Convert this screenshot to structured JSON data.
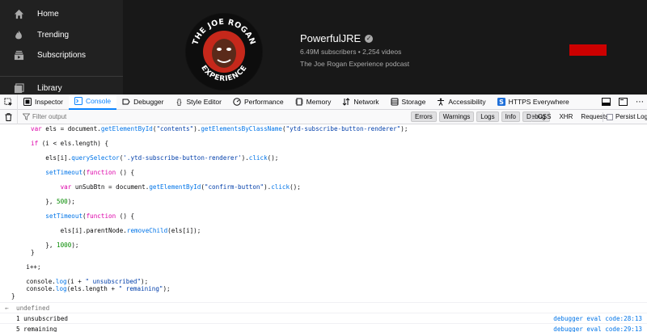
{
  "youtube": {
    "sidebar": [
      {
        "label": "Home",
        "icon": "home-icon"
      },
      {
        "label": "Trending",
        "icon": "flame-icon"
      },
      {
        "label": "Subscriptions",
        "icon": "subscriptions-icon"
      },
      {
        "label": "Library",
        "icon": "library-icon"
      }
    ],
    "channel": {
      "logo_text_top": "THE JOE ROGAN",
      "logo_text_bottom": "EXPERIENCE",
      "name": "PowerfulJRE",
      "stats": "6.49M subscribers • 2,254 videos",
      "description": "The Joe Rogan Experience podcast"
    },
    "colors": {
      "background": "#181818",
      "sidebar": "#212121",
      "subscribe": "#cc0000"
    }
  },
  "devtools": {
    "tabs": [
      {
        "label": "Inspector",
        "icon": "inspector-icon"
      },
      {
        "label": "Console",
        "icon": "console-icon"
      },
      {
        "label": "Debugger",
        "icon": "debugger-icon"
      },
      {
        "label": "Style Editor",
        "icon": "style-editor-icon"
      },
      {
        "label": "Performance",
        "icon": "performance-icon"
      },
      {
        "label": "Memory",
        "icon": "memory-icon"
      },
      {
        "label": "Network",
        "icon": "network-icon"
      },
      {
        "label": "Storage",
        "icon": "storage-icon"
      },
      {
        "label": "Accessibility",
        "icon": "accessibility-icon"
      },
      {
        "label": "HTTPS Everywhere",
        "icon": "https-everywhere-icon"
      }
    ],
    "active_tab": "Console",
    "filter_placeholder": "Filter output",
    "levels": [
      "Errors",
      "Warnings",
      "Logs",
      "Info",
      "Debug"
    ],
    "net_filters": [
      "CSS",
      "XHR",
      "Requests"
    ],
    "persist_label": "Persist Logs",
    "accent": "#0a84ff"
  },
  "console": {
    "code": [
      "var els = document.getElementById(\"contents\").getElementsByClassName(\"ytd-subscribe-button-renderer\");",
      "",
      "if (i < els.length) {",
      "",
      "    els[i].querySelector('.ytd-subscribe-button-renderer').click();",
      "",
      "    setTimeout(function () {",
      "",
      "        var unSubBtn = document.getElementById(\"confirm-button\").click();",
      "",
      "    }, 500);",
      "",
      "    setTimeout(function () {",
      "",
      "        els[i].parentNode.removeChild(els[i]);",
      "",
      "    }, 1000);",
      "}",
      "",
      "    i++;",
      "",
      "    console.log(i + \" unsubscribed\");",
      "    console.log(els.length + \" remaining\");",
      "}"
    ],
    "result": "undefined",
    "logs": [
      {
        "text": "1 unsubscribed",
        "source": "debugger eval code:28:13"
      },
      {
        "text": "5 remaining",
        "source": "debugger eval code:29:13"
      }
    ]
  }
}
